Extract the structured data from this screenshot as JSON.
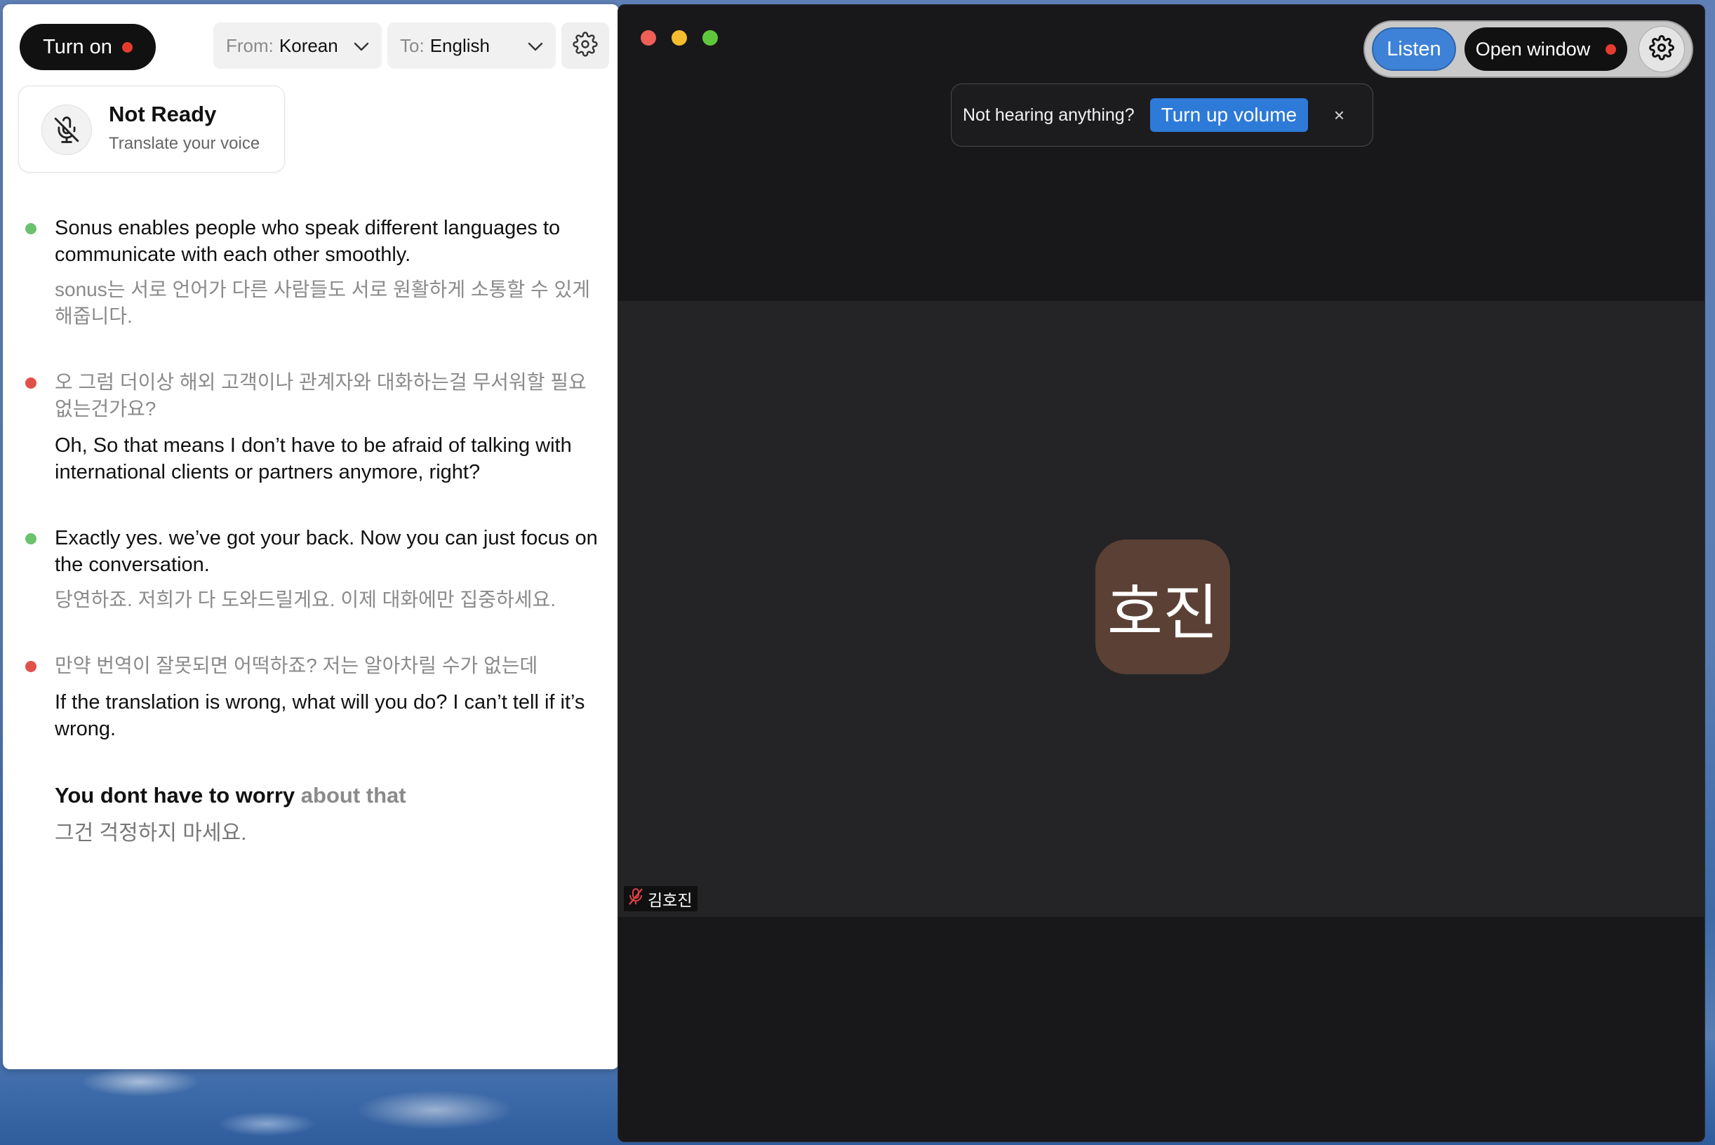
{
  "translator": {
    "turn_on_label": "Turn on",
    "from_prefix": "From:",
    "from_value": "Korean",
    "to_prefix": "To:",
    "to_value": "English",
    "status": {
      "title": "Not Ready",
      "subtitle": "Translate your voice"
    },
    "entries": [
      {
        "speaker_color": "green",
        "en": "Sonus enables people who speak different languages to communicate with each other smoothly.",
        "ko": "sonus는 서로 언어가 다른 사람들도 서로 원활하게 소통할 수 있게 해줍니다."
      },
      {
        "speaker_color": "red",
        "ko": "오 그럼 더이상 해외 고객이나 관계자와 대화하는걸 무서워할 필요 없는건가요?",
        "en": "Oh, So that means I don’t have to be afraid of talking with international clients or partners anymore, right?"
      },
      {
        "speaker_color": "green",
        "en": "Exactly yes. we’ve got your back. Now you can just focus on the conversation.",
        "ko": "당연하죠. 저희가 다 도와드릴게요. 이제 대화에만 집중하세요."
      },
      {
        "speaker_color": "red",
        "ko": "만약 번역이 잘못되면 어떡하죠? 저는 알아차릴 수가 없는데",
        "en": "If the translation is wrong, what will you do? I can’t tell if it’s wrong."
      }
    ],
    "live": {
      "en_final": "You dont have to worry",
      "en_pending": "about that",
      "ko": "그건 걱정하지 마세요."
    }
  },
  "meeting": {
    "listen_label": "Listen",
    "open_window_label": "Open window",
    "toast": {
      "text": "Not hearing anything?",
      "button": "Turn up volume",
      "close": "×"
    },
    "participant": {
      "avatar_text": "호진",
      "name": "김호진"
    }
  },
  "colors": {
    "record_dot": "#e53b2f",
    "listen_blue": "#3d82d6",
    "speaker_green": "#6cc26c",
    "speaker_red": "#e2504a",
    "avatar_brown": "#5a4035"
  },
  "icons": [
    "gear-icon",
    "mic-off-icon",
    "chevron-down-icon",
    "close-icon",
    "mic-muted-icon"
  ]
}
